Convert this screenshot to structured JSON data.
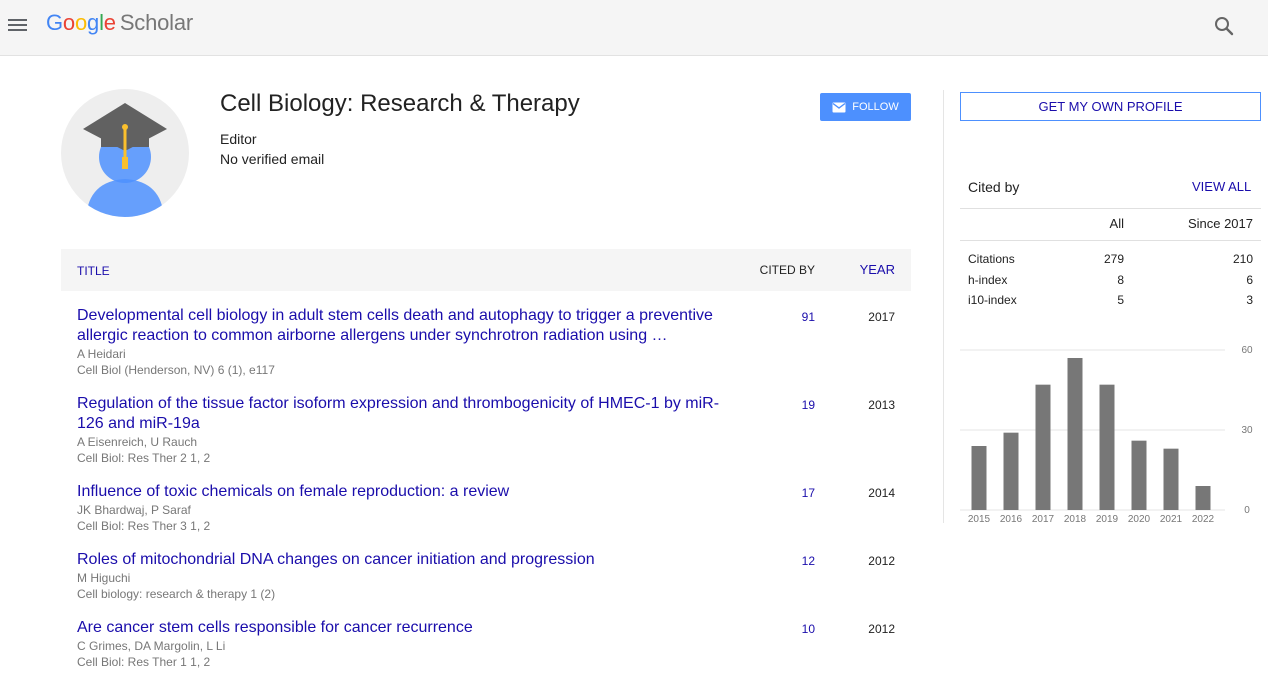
{
  "header": {
    "logo_google": "Google",
    "logo_scholar": "Scholar"
  },
  "profile": {
    "name": "Cell Biology: Research & Therapy",
    "affiliation": "Editor",
    "email": "No verified email",
    "follow_label": "FOLLOW"
  },
  "table": {
    "col_title": "TITLE",
    "col_cited": "CITED BY",
    "col_year": "YEAR",
    "articles": [
      {
        "title": "Developmental cell biology in adult stem cells death and autophagy to trigger a preventive allergic reaction to common airborne allergens under synchrotron radiation using …",
        "authors": "A Heidari",
        "venue": "Cell Biol (Henderson, NV) 6 (1), e117",
        "cited_by": "91",
        "year": "2017"
      },
      {
        "title": "Regulation of the tissue factor isoform expression and thrombogenicity of HMEC-1 by miR-126 and miR-19a",
        "authors": "A Eisenreich, U Rauch",
        "venue": "Cell Biol: Res Ther 2 1, 2",
        "cited_by": "19",
        "year": "2013"
      },
      {
        "title": "Influence of toxic chemicals on female reproduction: a review",
        "authors": "JK Bhardwaj, P Saraf",
        "venue": "Cell Biol: Res Ther 3 1, 2",
        "cited_by": "17",
        "year": "2014"
      },
      {
        "title": "Roles of mitochondrial DNA changes on cancer initiation and progression",
        "authors": "M Higuchi",
        "venue": "Cell biology: research & therapy 1 (2)",
        "cited_by": "12",
        "year": "2012"
      },
      {
        "title": "Are cancer stem cells responsible for cancer recurrence",
        "authors": "C Grimes, DA Margolin, L Li",
        "venue": "Cell Biol: Res Ther 1 1, 2",
        "cited_by": "10",
        "year": "2012"
      }
    ]
  },
  "sidebar": {
    "get_profile_label": "GET MY OWN PROFILE",
    "cited_by_label": "Cited by",
    "view_all_label": "VIEW ALL",
    "col_all": "All",
    "col_since": "Since 2017",
    "stats": [
      {
        "label": "Citations",
        "all": "279",
        "since": "210"
      },
      {
        "label": "h-index",
        "all": "8",
        "since": "6"
      },
      {
        "label": "i10-index",
        "all": "5",
        "since": "3"
      }
    ]
  },
  "colors": {
    "link": "#1a0dab",
    "accent": "#4d90fe",
    "bar": "#777777"
  },
  "icons": [
    "menu-icon",
    "search-icon",
    "mail-icon",
    "avatar-graduate-icon"
  ],
  "chart_data": {
    "type": "bar",
    "categories": [
      "2015",
      "2016",
      "2017",
      "2018",
      "2019",
      "2020",
      "2021",
      "2022"
    ],
    "values": [
      24,
      29,
      47,
      57,
      47,
      26,
      23,
      9
    ],
    "yticks": [
      "0",
      "30",
      "60"
    ],
    "ylim": [
      0,
      60
    ],
    "grid": true,
    "title": "",
    "xlabel": "",
    "ylabel": ""
  }
}
